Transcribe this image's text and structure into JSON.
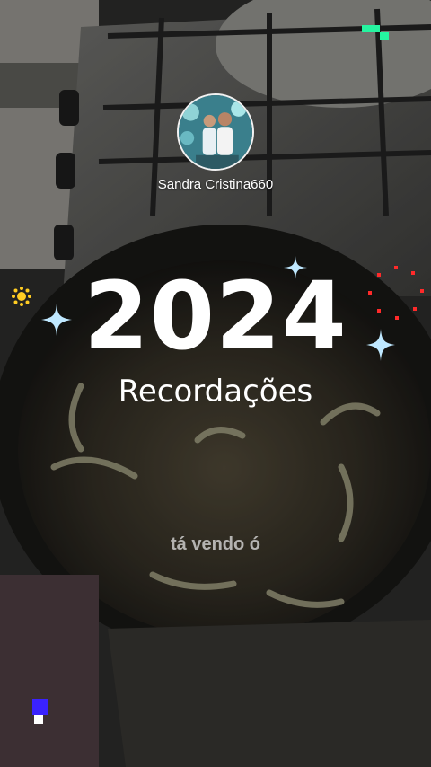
{
  "profile": {
    "username": "Sandra Cristina660"
  },
  "recap": {
    "year": "2024",
    "title": "Recordações"
  },
  "video": {
    "caption": "tá vendo ó"
  },
  "icons": {
    "top_right": "brand-logo-icon",
    "bottom_left": "brand-logo-icon",
    "sparkles": "sparkle-icon",
    "firework": "firework-icon",
    "sun": "sun-icon"
  },
  "colors": {
    "text": "#ffffff",
    "logo_green": "#25f4a0",
    "logo_blue": "#3a22ff",
    "sparkle": "#bfe8ff",
    "firework": "#ff2a2a",
    "sun": "#ffcc22"
  }
}
